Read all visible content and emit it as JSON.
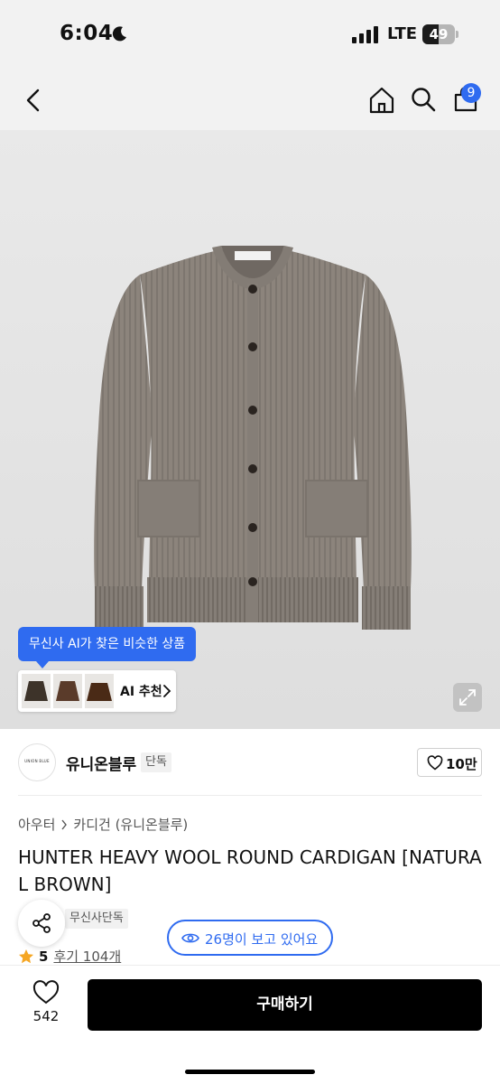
{
  "status_bar": {
    "time": "6:04",
    "network": "LTE",
    "battery": "49",
    "battery_level": 0.49
  },
  "header": {
    "cart_count": "9"
  },
  "product_image": {
    "ai_tooltip": "무신사 AI가 찾은 비슷한 상품",
    "ai_recommend_label": "AI 추천"
  },
  "brand": {
    "logo_text": "UNION BLUE",
    "name": "유니온블루",
    "tag": "단독",
    "likes": "10만"
  },
  "product": {
    "breadcrumb": [
      "아우터",
      "카디건 (유니온블루)"
    ],
    "title": "HUNTER HEAVY WOOL ROUND CARDIGAN [NATURAL BROWN]",
    "store_tag": "무신사단독",
    "viewers": "26명이 보고 있어요",
    "rating": "5",
    "reviews": "후기 104개"
  },
  "bottom_bar": {
    "wish_count": "542",
    "buy_label": "구매하기"
  },
  "colors": {
    "accent": "#2f6bf0",
    "buy_button": "#000000",
    "cardigan": "#8c847c",
    "star": "#f5a623"
  },
  "icons": [
    "moon-icon",
    "signal-icon",
    "back-icon",
    "home-icon",
    "search-icon",
    "cart-icon",
    "chevron-right-icon",
    "expand-icon",
    "heart-icon",
    "share-icon",
    "eye-icon",
    "star-icon"
  ]
}
